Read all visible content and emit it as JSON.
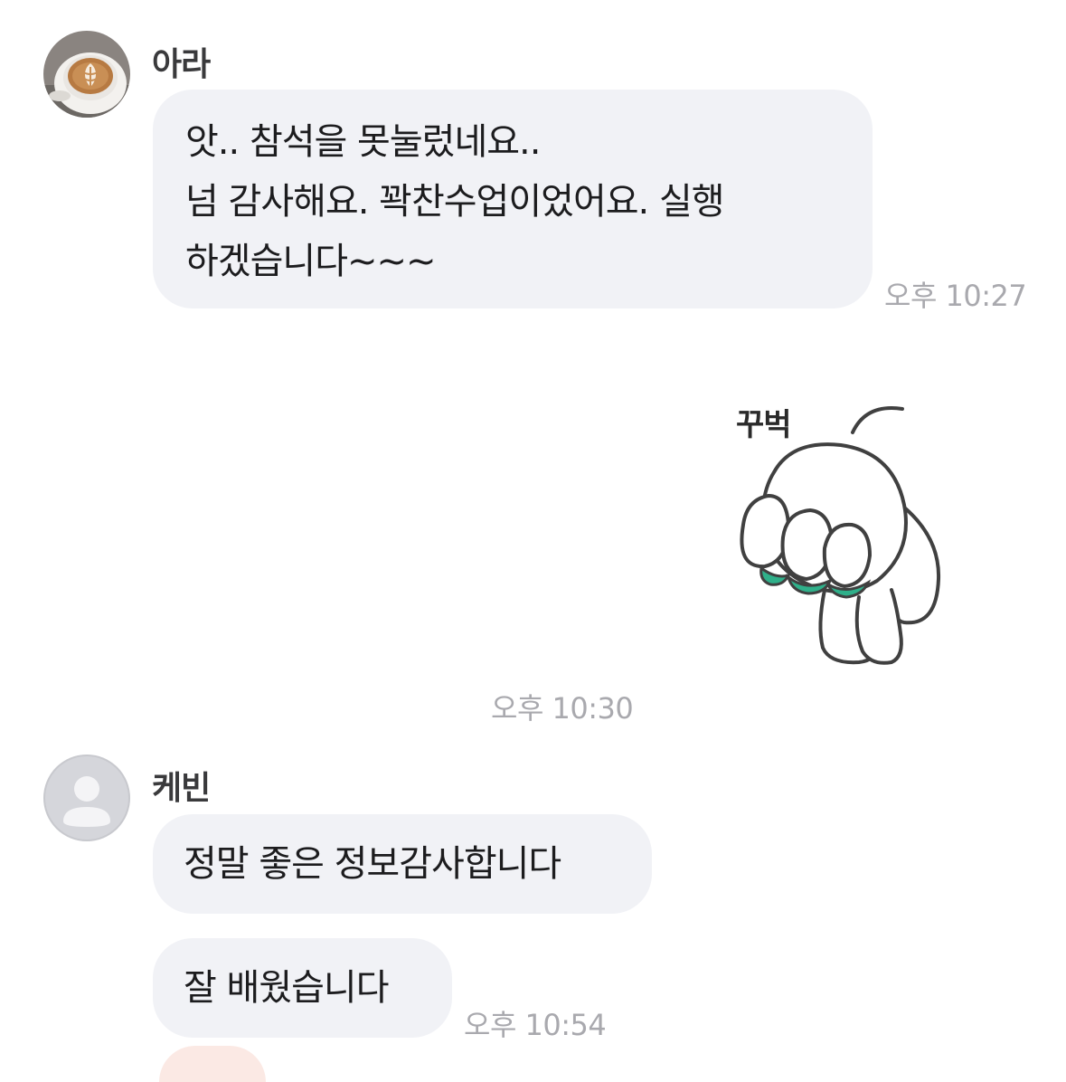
{
  "messages": [
    {
      "sender": "아라",
      "lines": [
        "앗.. 참석을 못눌렀네요..",
        "넘 감사해요. 꽉찬수업이었어요. 실행",
        "하겠습니다~~~"
      ],
      "time": "오후 10:27"
    },
    {
      "sticker_caption": "꾸벅",
      "time": "오후 10:30"
    },
    {
      "sender": "케빈",
      "bubbles": [
        "정말 좋은 정보감사합니다",
        "잘 배웠습니다"
      ],
      "time": "오후 10:54"
    }
  ],
  "icons": {
    "ara_avatar": "latte-art-photo",
    "kevin_avatar": "default-user-icon",
    "sticker": "bowing-bunny-sticker"
  },
  "colors": {
    "bubble_bg": "#f1f2f6",
    "timestamp": "#a9a9ae",
    "default_avatar_bg": "#d5d6db",
    "sticker_accent": "#2fb08a"
  }
}
